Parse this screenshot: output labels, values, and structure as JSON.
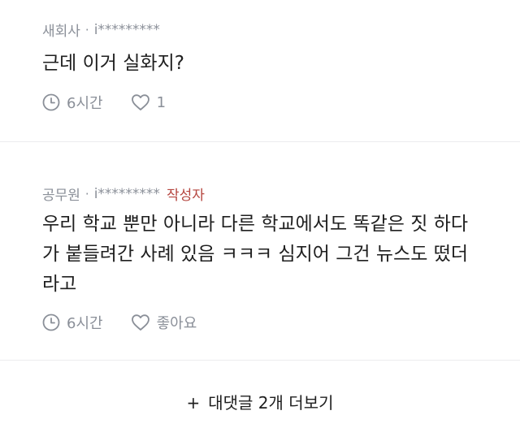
{
  "comments": [
    {
      "author": "새회사",
      "user": "i*********",
      "text": "근데 이거 실화지?",
      "time": "6시간",
      "likes": "1"
    },
    {
      "author": "공무원",
      "user": "i*********",
      "author_tag": "작성자",
      "text_lines": [
        "우리 학교 뿐만 아니라 다른 학교에서도 똑같은 짓 하다",
        "가 붙들려간 사례 있음 ㅋㅋㅋ 심지어 그건 뉴스도 떴더",
        "라고"
      ],
      "time": "6시간",
      "likes": "좋아요"
    }
  ],
  "separator": "·",
  "more": {
    "plus": "+",
    "label": "대댓글 2개 더보기"
  },
  "colors": {
    "meta": "#8a8f98",
    "author_tag": "#b5463f",
    "divider": "#ececee"
  },
  "icons": {
    "time": "clock-icon",
    "like": "heart-icon"
  }
}
